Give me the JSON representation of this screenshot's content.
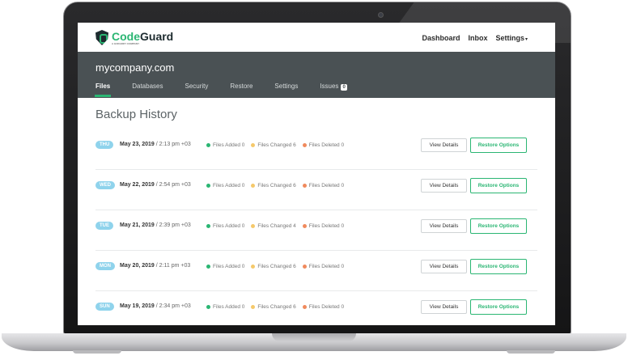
{
  "colors": {
    "brand_green": "#2bb673",
    "header_bg": "#4a5154",
    "day_badge": "#8fd3ec",
    "files_added_dot": "#2bb673",
    "files_changed_dot": "#f5c96b",
    "files_deleted_dot": "#f08a5d"
  },
  "brand": {
    "code": "Code",
    "guard": "Guard",
    "tagline": "A GODADDY COMPANY"
  },
  "topnav": {
    "dashboard": "Dashboard",
    "inbox": "Inbox",
    "settings": "Settings",
    "settings_caret": "▾"
  },
  "site": {
    "name": "mycompany.com"
  },
  "tabs": [
    {
      "label": "Files"
    },
    {
      "label": "Databases"
    },
    {
      "label": "Security"
    },
    {
      "label": "Restore"
    },
    {
      "label": "Settings"
    },
    {
      "label": "Issues",
      "badge": "0"
    }
  ],
  "page": {
    "title": "Backup History"
  },
  "buttons": {
    "details": "View Details",
    "restore": "Restore Options"
  },
  "backups": [
    {
      "day": "THU",
      "date": "May 23, 2019",
      "time": "/ 2:13 pm +03",
      "added": "Files Added 0",
      "changed": "Files Changed 6",
      "deleted": "Files Deleted 0"
    },
    {
      "day": "WED",
      "date": "May 22, 2019",
      "time": "/ 2:54 pm +03",
      "added": "Files Added 0",
      "changed": "Files Changed 6",
      "deleted": "Files Deleted 0"
    },
    {
      "day": "TUE",
      "date": "May 21, 2019",
      "time": "/ 2:39 pm +03",
      "added": "Files Added 0",
      "changed": "Files Changed 4",
      "deleted": "Files Deleted 0"
    },
    {
      "day": "MON",
      "date": "May 20, 2019",
      "time": "/ 2:11 pm +03",
      "added": "Files Added 0",
      "changed": "Files Changed 6",
      "deleted": "Files Deleted 0"
    },
    {
      "day": "SUN",
      "date": "May 19, 2019",
      "time": "/ 2:34 pm +03",
      "added": "Files Added 0",
      "changed": "Files Changed 6",
      "deleted": "Files Deleted 0"
    }
  ]
}
